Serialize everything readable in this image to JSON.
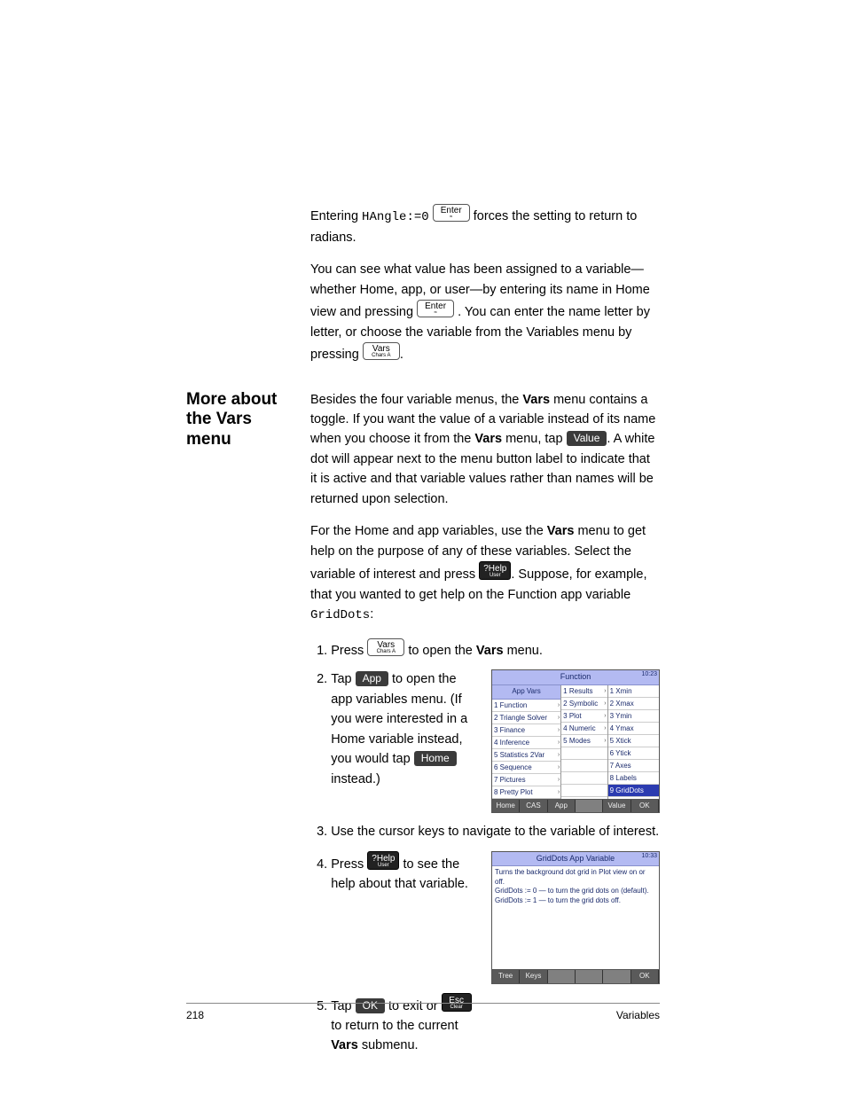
{
  "intro": {
    "p1_a": "Entering ",
    "p1_code": "HAngle:=0",
    "p1_b": " forces the setting to return to radians.",
    "p2_a": "You can see what value has been assigned to a variable—whether Home, app, or user—by entering its name in Home view and pressing ",
    "p2_b": ". You can enter the name letter by letter, or choose the variable from the Variables menu by pressing ",
    "p2_c": "."
  },
  "keys": {
    "enter_top": "Enter",
    "enter_sub": "≈",
    "vars_top": "Vars",
    "vars_sub": "Chars  A",
    "help_top": "?Help",
    "help_sub": "User",
    "esc_top": "Esc",
    "esc_sub": "Clear"
  },
  "softbtns": {
    "value": "Value",
    "app": "App",
    "home": "Home",
    "ok": "OK"
  },
  "section_heading": "More about the Vars menu",
  "section": {
    "p1_a": "Besides the four variable menus, the ",
    "p1_b": " menu contains a toggle. If you want the value of a variable instead of its name when you choose it from the ",
    "p1_c": " menu, tap ",
    "p1_d": ". A white dot will appear next to the menu button label to indicate that it is active and that variable values rather than names will be returned upon selection.",
    "p2_a": "For the Home and app variables, use the ",
    "p2_b": " menu to get help on the purpose of any of these variables. Select the variable of interest and press ",
    "p2_c": ". Suppose, for example, that you wanted to get help on the Function app variable ",
    "p2_code": "GridDots",
    "p2_d": ":",
    "vars_bold": "Vars"
  },
  "steps": {
    "s1_a": "Press ",
    "s1_b": " to open the ",
    "s1_c": " menu.",
    "s2_a": "Tap ",
    "s2_b": " to open the app variables menu. (If you were interested in a Home variable instead, you would tap ",
    "s2_c": " instead.)",
    "s3": "Use the cursor keys to navigate to the variable of interest.",
    "s4_a": "Press ",
    "s4_b": " to see the help about that variable.",
    "s5_a": "Tap ",
    "s5_b": " to exit or ",
    "s5_c": " to return to the current ",
    "s5_d": " submenu."
  },
  "ss1": {
    "title": "Function",
    "time": "10:23",
    "col1_hd": "App Vars",
    "col1": [
      "1 Function",
      "2 Triangle Solver",
      "3 Finance",
      "4 Inference",
      "5 Statistics 2Var",
      "6 Sequence",
      "7 Pictures",
      "8 Pretty Plot"
    ],
    "col2": [
      "1 Results",
      "2 Symbolic",
      "3 Plot",
      "4 Numeric",
      "5 Modes"
    ],
    "col3": [
      "1 Xmin",
      "2 Xmax",
      "3 Ymin",
      "4 Ymax",
      "5 Xtick",
      "6 Ytick",
      "7 Axes",
      "8 Labels",
      "9 GridDots"
    ],
    "soft": [
      "Home",
      "CAS",
      "App",
      "",
      "Value",
      "OK"
    ]
  },
  "ss2": {
    "title": "GridDots App Variable",
    "time": "10:33",
    "lines": [
      "Turns the background dot grid in Plot view on or off.",
      "GridDots := 0 — to turn the grid dots on (default).",
      "GridDots := 1 — to turn the grid dots off."
    ],
    "soft": [
      "Tree",
      "Keys",
      "",
      "",
      "",
      "OK"
    ]
  },
  "footer": {
    "page": "218",
    "chapter": "Variables"
  }
}
